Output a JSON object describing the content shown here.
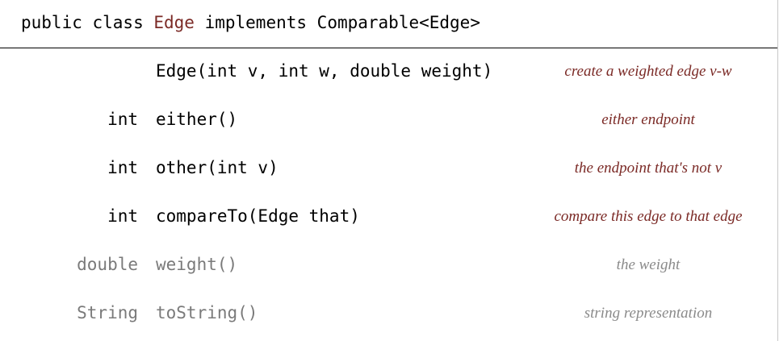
{
  "header": {
    "prefix": "public class ",
    "class_name": "Edge",
    "suffix": " implements Comparable<Edge>"
  },
  "rows": [
    {
      "type": "",
      "signature": "Edge(int v, int w, double weight)",
      "description": "create a weighted edge v-w",
      "style": "primary"
    },
    {
      "type": "int",
      "signature": "either()",
      "description": "either endpoint",
      "style": "primary"
    },
    {
      "type": "int",
      "signature": "other(int v)",
      "description": "the endpoint that's not v",
      "style": "primary"
    },
    {
      "type": "int",
      "signature": "compareTo(Edge that)",
      "description": "compare this edge to that edge",
      "style": "primary"
    },
    {
      "type": "double",
      "signature": "weight()",
      "description": "the weight",
      "style": "secondary"
    },
    {
      "type": "String",
      "signature": "toString()",
      "description": "string representation",
      "style": "secondary"
    }
  ],
  "colors": {
    "accent": "#7b2a26",
    "muted_text": "#7a7a7a",
    "background": "#ffffff"
  }
}
